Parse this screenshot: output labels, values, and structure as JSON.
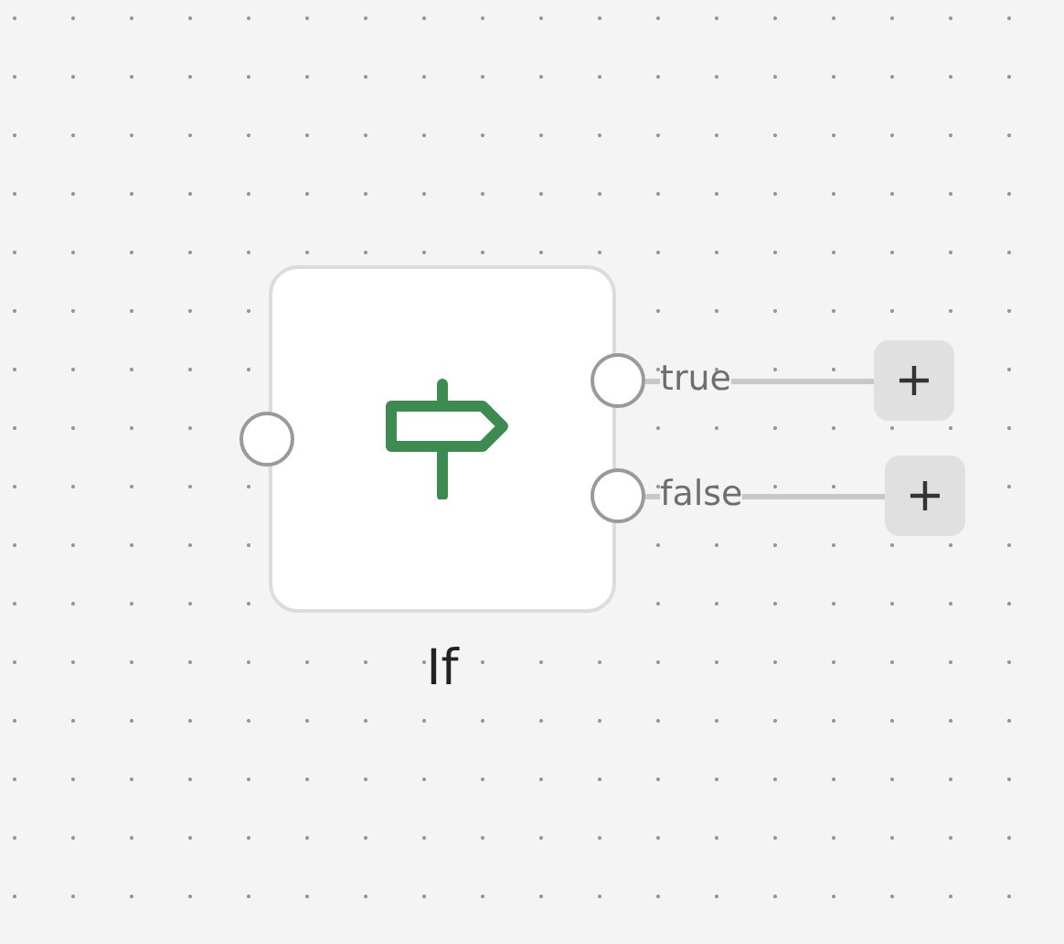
{
  "node": {
    "label": "If"
  },
  "outputs": [
    {
      "label": "true"
    },
    {
      "label": "false"
    }
  ]
}
